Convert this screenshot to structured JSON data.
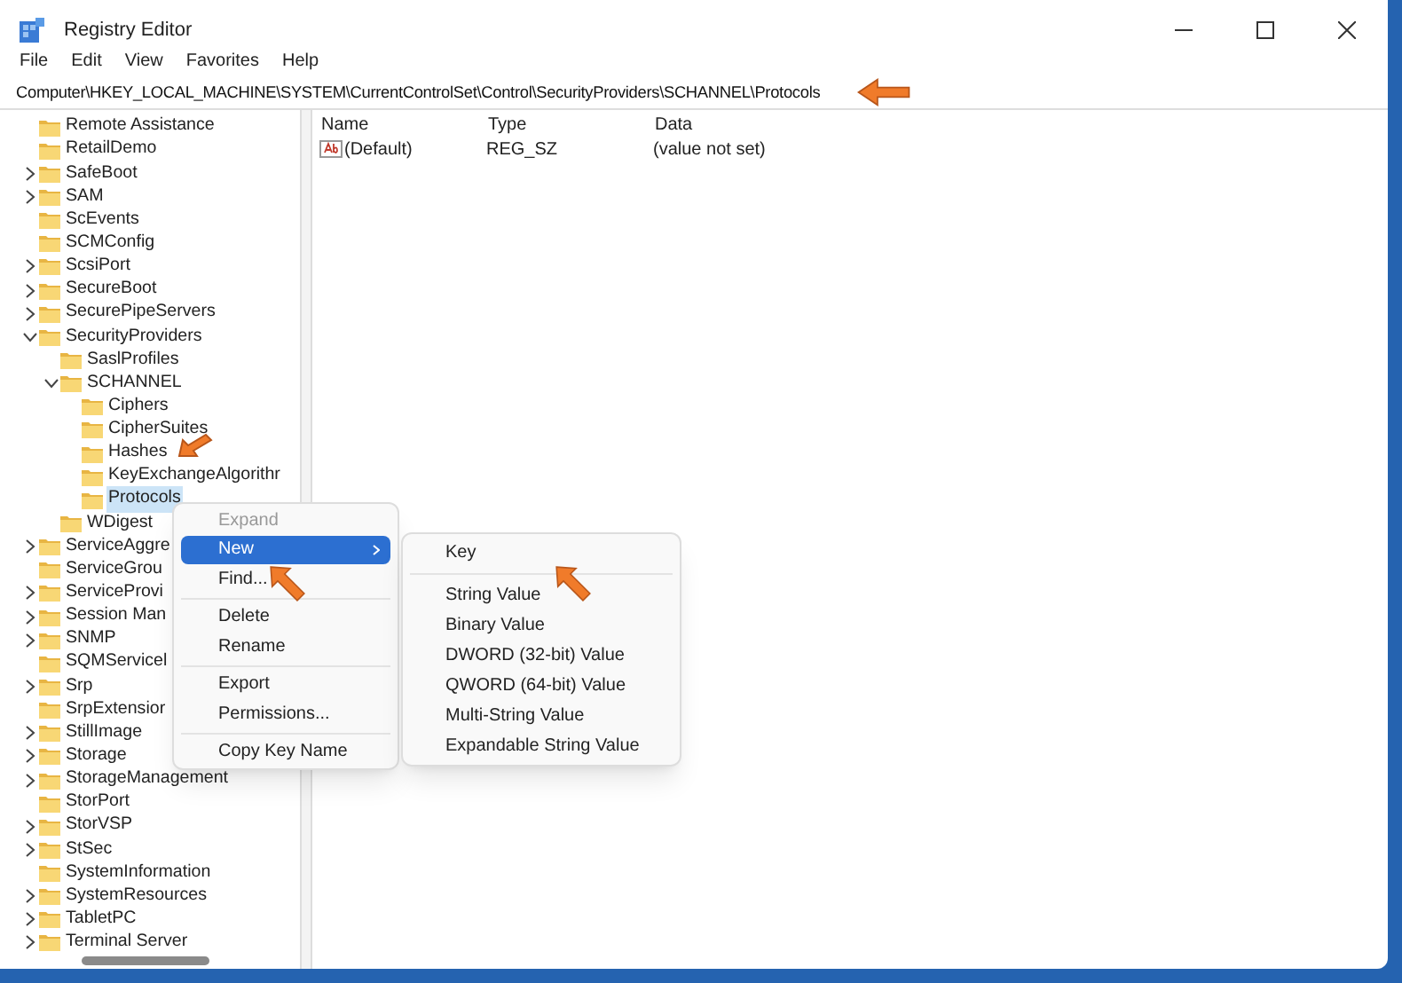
{
  "window": {
    "title": "Registry Editor"
  },
  "menu_bar": [
    "File",
    "Edit",
    "View",
    "Favorites",
    "Help"
  ],
  "address": "Computer\\HKEY_LOCAL_MACHINE\\SYSTEM\\CurrentControlSet\\Control\\SecurityProviders\\SCHANNEL\\Protocols",
  "tree": [
    {
      "label": "Remote Assistance",
      "selected": false
    },
    {
      "label": "RetailDemo",
      "selected": false
    },
    {
      "label": "SafeBoot",
      "expanded": false,
      "selected": false
    },
    {
      "label": "SAM",
      "expanded": false,
      "selected": false
    },
    {
      "label": "ScEvents",
      "selected": false
    },
    {
      "label": "SCMConfig",
      "selected": false
    },
    {
      "label": "ScsiPort",
      "expanded": false,
      "selected": false
    },
    {
      "label": "SecureBoot",
      "expanded": false,
      "selected": false
    },
    {
      "label": "SecurePipeServers",
      "expanded": false,
      "selected": false
    },
    {
      "label": "SecurityProviders",
      "expanded": true,
      "selected": false,
      "children": [
        {
          "label": "SaslProfiles",
          "selected": false
        },
        {
          "label": "SCHANNEL",
          "expanded": true,
          "selected": false,
          "children": [
            {
              "label": "Ciphers",
              "selected": false
            },
            {
              "label": "CipherSuites",
              "selected": false
            },
            {
              "label": "Hashes",
              "selected": false
            },
            {
              "label": "KeyExchangeAlgorithr",
              "selected": false
            },
            {
              "label": "Protocols",
              "selected": true
            }
          ]
        },
        {
          "label": "WDigest",
          "selected": false
        }
      ]
    },
    {
      "label": "ServiceAggre",
      "expanded": false,
      "selected": false
    },
    {
      "label": "ServiceGrou",
      "selected": false
    },
    {
      "label": "ServiceProvi",
      "expanded": false,
      "selected": false
    },
    {
      "label": "Session Man",
      "expanded": false,
      "selected": false
    },
    {
      "label": "SNMP",
      "expanded": false,
      "selected": false
    },
    {
      "label": "SQMServicel",
      "selected": false
    },
    {
      "label": "Srp",
      "expanded": false,
      "selected": false
    },
    {
      "label": "SrpExtensior",
      "selected": false
    },
    {
      "label": "StillImage",
      "expanded": false,
      "selected": false
    },
    {
      "label": "Storage",
      "expanded": false,
      "selected": false
    },
    {
      "label": "StorageManagement",
      "expanded": false,
      "selected": false
    },
    {
      "label": "StorPort",
      "selected": false
    },
    {
      "label": "StorVSP",
      "expanded": false,
      "selected": false
    },
    {
      "label": "StSec",
      "expanded": false,
      "selected": false
    },
    {
      "label": "SystemInformation",
      "selected": false
    },
    {
      "label": "SystemResources",
      "expanded": false,
      "selected": false
    },
    {
      "label": "TabletPC",
      "expanded": false,
      "selected": false
    },
    {
      "label": "Terminal Server",
      "expanded": false,
      "selected": false
    }
  ],
  "table": {
    "columns": [
      "Name",
      "Type",
      "Data"
    ],
    "rows": [
      {
        "name": "(Default)",
        "type": "REG_SZ",
        "data": "(value not set)"
      }
    ]
  },
  "context_menu": [
    {
      "kind": "item",
      "label": "Expand",
      "disabled": true,
      "selected": false,
      "submenu": false
    },
    {
      "kind": "item",
      "label": "New",
      "disabled": false,
      "selected": true,
      "submenu": true
    },
    {
      "kind": "item",
      "label": "Find...",
      "disabled": false,
      "selected": false,
      "submenu": false
    },
    {
      "kind": "separator"
    },
    {
      "kind": "item",
      "label": "Delete",
      "disabled": false,
      "selected": false,
      "submenu": false
    },
    {
      "kind": "item",
      "label": "Rename",
      "disabled": false,
      "selected": false,
      "submenu": false
    },
    {
      "kind": "separator"
    },
    {
      "kind": "item",
      "label": "Export",
      "disabled": false,
      "selected": false,
      "submenu": false
    },
    {
      "kind": "item",
      "label": "Permissions...",
      "disabled": false,
      "selected": false,
      "submenu": false
    },
    {
      "kind": "separator"
    },
    {
      "kind": "item",
      "label": "Copy Key Name",
      "disabled": false,
      "selected": false,
      "submenu": false
    }
  ],
  "submenu": [
    {
      "kind": "item",
      "label": "Key"
    },
    {
      "kind": "separator"
    },
    {
      "kind": "item",
      "label": "String Value"
    },
    {
      "kind": "item",
      "label": "Binary Value"
    },
    {
      "kind": "item",
      "label": "DWORD (32-bit) Value"
    },
    {
      "kind": "item",
      "label": "QWORD (64-bit) Value"
    },
    {
      "kind": "item",
      "label": "Multi-String Value"
    },
    {
      "kind": "item",
      "label": "Expandable String Value"
    }
  ]
}
